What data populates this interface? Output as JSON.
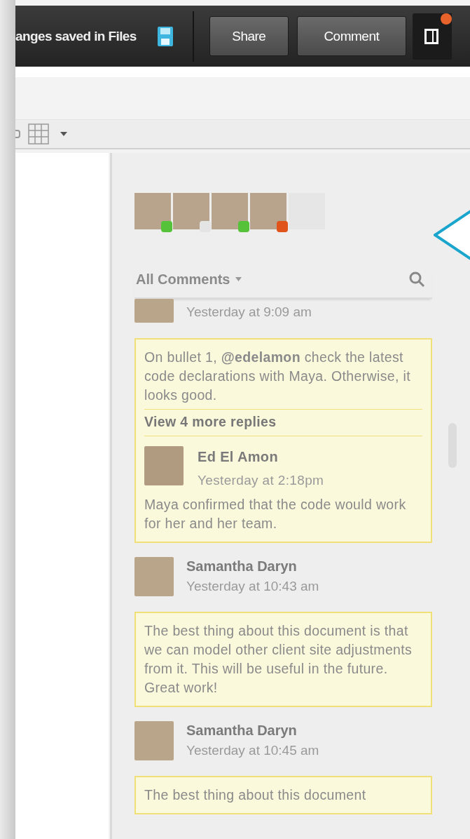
{
  "top_bar": {
    "save_status": "anges saved in Files",
    "buttons": [
      "Share",
      "Comment"
    ],
    "notification": true
  },
  "comments_panel": {
    "avatars": [
      {
        "color": "#55c23a",
        "faded": false
      },
      {
        "color": "#e4e4e4",
        "faded": false
      },
      {
        "color": "#55c23a",
        "faded": false
      },
      {
        "color": "#e0541c",
        "faded": false
      },
      {
        "faded": true
      }
    ],
    "filter": "All Comments",
    "comments": [
      {
        "kind": "thread",
        "time": "Yesterday at 9:09 am",
        "text": "On bullet 1, **@edelamon** check the latest code declarations with Maya. Otherwise, it looks good.",
        "more_replies": "View 4 more replies",
        "reply": {
          "author": "Ed El Amon",
          "time": "Yesterday at 2:18pm",
          "text": "Maya confirmed that the code would work for her and her team."
        }
      },
      {
        "kind": "comment",
        "author": "Samantha Daryn",
        "time": "Yesterday at 10:43 am",
        "text": "The best thing about this document is that we can model other client site adjustments from it. This will be useful in the future. Great work!"
      },
      {
        "kind": "comment",
        "author": "Samantha Daryn",
        "time": "Yesterday at 10:45 am",
        "text": "The best thing about this document"
      }
    ]
  }
}
